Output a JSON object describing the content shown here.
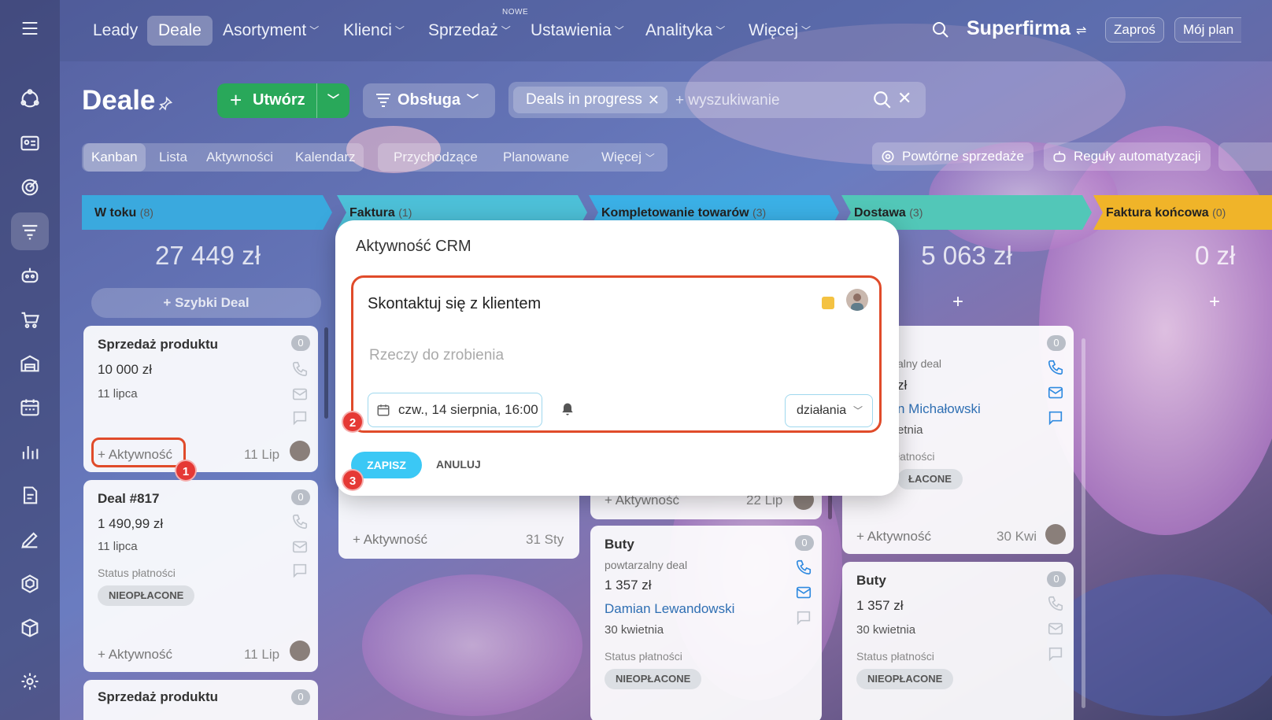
{
  "colors": {
    "green": "#29a85a",
    "red": "#e04b2a",
    "save": "#3bc8f5",
    "link": "#2f6fb3"
  },
  "sidebar": {
    "items": [
      "menu-icon",
      "robot-crm-icon",
      "contact-card-icon",
      "target-icon",
      "funnel-icon",
      "bot-icon",
      "cart-icon",
      "warehouse-icon",
      "calendar-icon",
      "chart-icon",
      "document-icon",
      "pen-icon",
      "hexagon-icon",
      "box-icon",
      "settings-icon"
    ]
  },
  "topnav": {
    "items": [
      {
        "label": "Leady"
      },
      {
        "label": "Deale"
      },
      {
        "label": "Asortyment"
      },
      {
        "label": "Klienci"
      },
      {
        "label": "Sprzedaż"
      },
      {
        "label": "Ustawienia"
      },
      {
        "label": "Analityka"
      },
      {
        "label": "Więcej"
      }
    ],
    "new_tag": "NOWE",
    "brand": "Superfirma",
    "invite": "Zaproś",
    "plan": "Mój plan"
  },
  "header": {
    "title": "Deale",
    "create": "Utwórz",
    "service": "Obsługa",
    "filter_chip": "Deals in progress",
    "search_placeholder": "+ wyszukiwanie"
  },
  "views": {
    "tabs": [
      "Kanban",
      "Lista",
      "Aktywności",
      "Kalendarz"
    ],
    "filters": [
      "Przychodzące",
      "Planowane",
      "Więcej"
    ],
    "repeat": "Powtórne sprzedaże",
    "rules": "Reguły automatyzacji"
  },
  "columns": [
    {
      "name": "W toku",
      "count": "(8)",
      "sum": "27 449 zł",
      "color": "#3aa9de"
    },
    {
      "name": "Faktura",
      "count": "(1)",
      "color": "#4dc0d8"
    },
    {
      "name": "Kompletowanie towarów",
      "count": "(3)",
      "color": "#3bb0e6"
    },
    {
      "name": "Dostawa",
      "count": "(3)",
      "sum": "5 063 zł",
      "color": "#52c7b8"
    },
    {
      "name": "Faktura końcowa",
      "count": "(0)",
      "sum": "0 zł",
      "color": "#f0b429"
    }
  ],
  "quick_deal": "+ Szybki Deal",
  "cards": {
    "c1": {
      "title": "Sprzedaż produktu",
      "amount": "10 000 zł",
      "date": "11 lipca",
      "badge": "0",
      "activity": "+ Aktywność",
      "short": "11 Lip"
    },
    "c2": {
      "title": "Deal #817",
      "amount": "1 490,99 zł",
      "date": "11 lipca",
      "status": "Status płatności",
      "unpaid": "NIEOPŁACONE",
      "badge": "0",
      "activity": "+ Aktywność",
      "short": "11 Lip"
    },
    "c3": {
      "title": "Sprzedaż produktu",
      "badge": "0"
    },
    "c4": {
      "activity": "+ Aktywność",
      "short": "31 Sty"
    },
    "c5": {
      "activity": "+ Aktywność",
      "short": "22 Lip"
    },
    "c6": {
      "title": "Buty",
      "sub": "powtarzalny deal",
      "amount": "1 357 zł",
      "client": "Damian Lewandowski",
      "date": "30 kwietnia",
      "status": "Status płatności",
      "unpaid": "NIEOPŁACONE",
      "badge": "0"
    },
    "c7": {
      "sub": "alny deal",
      "amount": "zł",
      "client": "n Michałowski",
      "date": "etnia",
      "status": "łatności",
      "unpaid": "ŁACONE",
      "badge": "0",
      "activity": "+ Aktywność",
      "short": "30 Kwi"
    },
    "c8": {
      "title": "Buty",
      "amount": "1 357 zł",
      "date": "30 kwietnia",
      "status": "Status płatności",
      "unpaid": "NIEOPŁACONE",
      "badge": "0"
    }
  },
  "modal": {
    "title": "Aktywność CRM",
    "task": "Skontaktuj się z klientem",
    "placeholder": "Rzeczy do zrobienia",
    "datetime": "czw., 14 sierpnia, 16:00",
    "actions": "działania",
    "save": "ZAPISZ",
    "cancel": "ANULUJ"
  },
  "steps": [
    "1",
    "2",
    "3"
  ]
}
